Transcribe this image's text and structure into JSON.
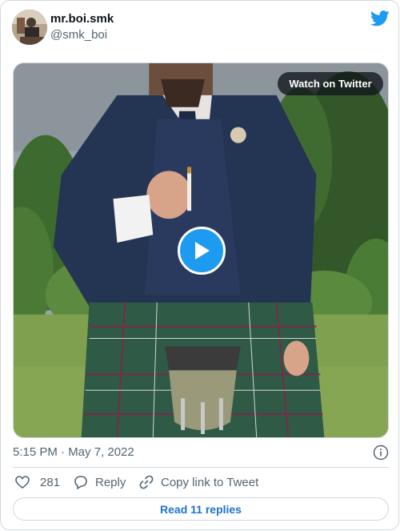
{
  "tweet": {
    "display_name": "mr.boi.smk",
    "handle": "@smk_boi",
    "timestamp": "5:15 PM · May 7, 2022"
  },
  "media": {
    "watch_label": "Watch on Twitter"
  },
  "actions": {
    "like_count": "281",
    "reply_label": "Reply",
    "copy_label": "Copy link to Tweet"
  },
  "replies": {
    "label": "Read 11 replies"
  },
  "colors": {
    "twitter_blue": "#1d9bf0",
    "link_blue": "#1d73c9",
    "muted_text": "#536471",
    "border": "#cfd9de"
  },
  "icons": [
    "twitter-bird-icon",
    "play-icon",
    "info-icon",
    "heart-icon",
    "reply-bubble-icon",
    "link-icon"
  ]
}
